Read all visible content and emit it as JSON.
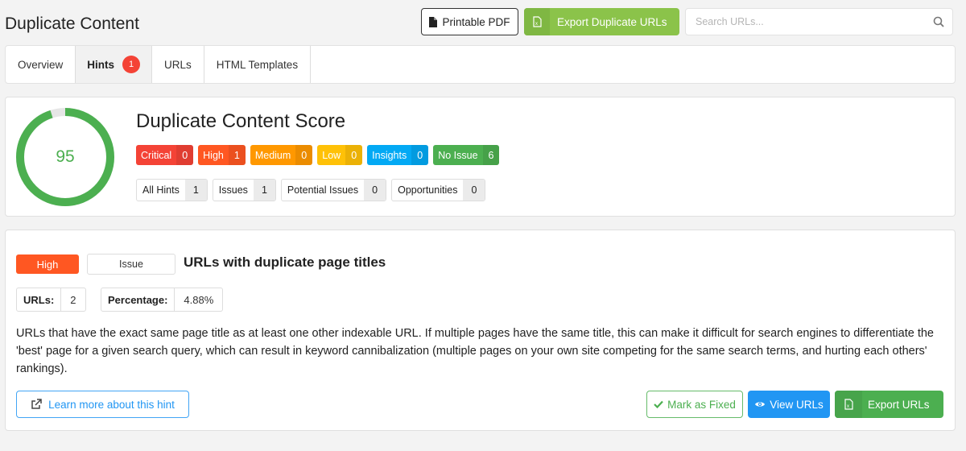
{
  "page": {
    "title": "Duplicate Content"
  },
  "toolbar": {
    "pdf_label": "Printable PDF",
    "export_label": "Export Duplicate URLs",
    "search_placeholder": "Search URLs..."
  },
  "tabs": [
    {
      "label": "Overview",
      "active": false
    },
    {
      "label": "Hints",
      "active": true,
      "badge": "1"
    },
    {
      "label": "URLs",
      "active": false
    },
    {
      "label": "HTML Templates",
      "active": false
    }
  ],
  "score": {
    "title": "Duplicate Content Score",
    "value": "95",
    "percent": 95,
    "color": "#4caf50",
    "track_color": "#e6e6e6"
  },
  "severities": [
    {
      "label": "Critical",
      "count": "0",
      "color": "#f44336"
    },
    {
      "label": "High",
      "count": "1",
      "color": "#ff5722"
    },
    {
      "label": "Medium",
      "count": "0",
      "color": "#ff9800"
    },
    {
      "label": "Low",
      "count": "0",
      "color": "#ffc107"
    },
    {
      "label": "Insights",
      "count": "0",
      "color": "#03a9f4"
    },
    {
      "label": "No Issue",
      "count": "6",
      "color": "#4caf50"
    }
  ],
  "types": [
    {
      "label": "All Hints",
      "count": "1"
    },
    {
      "label": "Issues",
      "count": "1"
    },
    {
      "label": "Potential Issues",
      "count": "0"
    },
    {
      "label": "Opportunities",
      "count": "0"
    }
  ],
  "hint": {
    "priority": "High",
    "type": "Issue",
    "title": "URLs with duplicate page titles",
    "urls_label": "URLs:",
    "urls_value": "2",
    "pct_label": "Percentage:",
    "pct_value": "4.88%",
    "description": "URLs that have the exact same page title as at least one other indexable URL. If multiple pages have the same title, this can make it difficult for search engines to differentiate the 'best' page for a given search query, which can result in keyword cannibalization (multiple pages on your own site competing for the same search terms, and hurting each others' rankings).",
    "learn_label": "Learn more about this hint",
    "fixed_label": "Mark as Fixed",
    "view_label": "View URLs",
    "export_label": "Export URLs"
  }
}
